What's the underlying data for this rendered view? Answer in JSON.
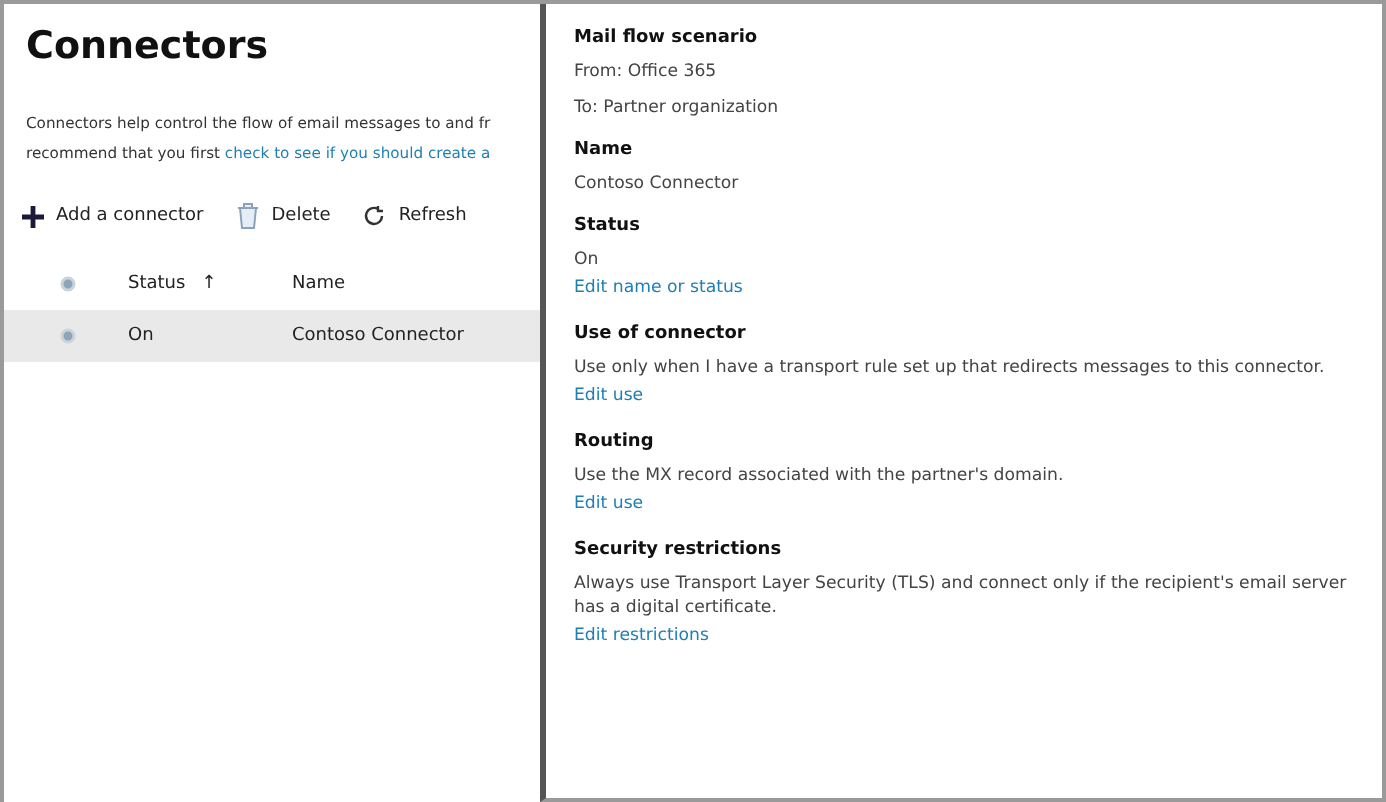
{
  "page": {
    "title": "Connectors",
    "intro_line_1": "Connectors help control the flow of email messages to and fr",
    "intro_line_2": "recommend that you first ",
    "intro_link": "check to see if you should create a"
  },
  "toolbar": [
    {
      "kind": "add",
      "label": "Add a connector"
    },
    {
      "kind": "delete",
      "label": "Delete"
    },
    {
      "kind": "refresh",
      "label": "Refresh"
    }
  ],
  "table": {
    "columns": [
      "Status",
      "Name"
    ],
    "sort_arrow": "↑",
    "rows": [
      {
        "status": "On",
        "name": "Contoso Connector",
        "selected": true
      }
    ]
  },
  "details": {
    "sections": [
      {
        "heading": "Mail flow scenario",
        "lines": [
          "From: Office 365",
          "To: Partner organization"
        ]
      },
      {
        "heading": "Name",
        "lines": [
          "Contoso Connector"
        ]
      },
      {
        "heading": "Status",
        "lines": [
          "On"
        ],
        "link": "Edit name or status"
      },
      {
        "heading": "Use of connector",
        "lines": [
          "Use only when I have a transport rule set up that redirects messages to this connector."
        ],
        "link": "Edit use"
      },
      {
        "heading": "Routing",
        "lines": [
          "Use the MX record associated with the partner's domain."
        ],
        "link": "Edit use"
      },
      {
        "heading": "Security restrictions",
        "lines": [
          "Always use Transport Layer Security (TLS) and connect only if the recipient's email server has a digital certificate."
        ],
        "link": "Edit restrictions"
      }
    ]
  }
}
